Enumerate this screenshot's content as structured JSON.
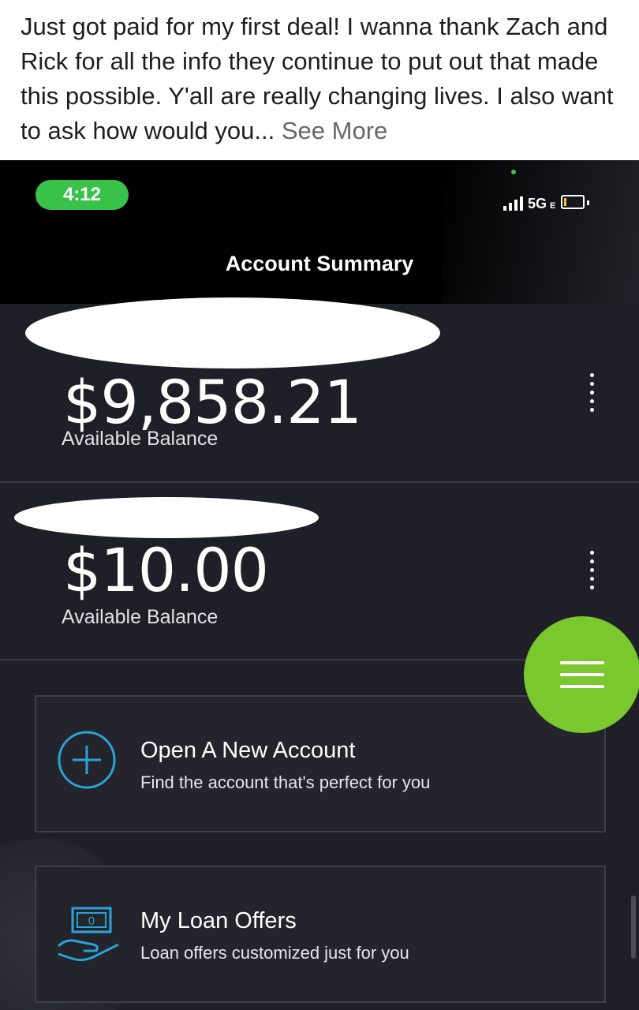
{
  "post": {
    "text": "Just got paid for my first deal! I wanna thank Zach and Rick for all the info they continue to put out that made this possible. Y'all are really changing lives. I also want to ask how would you...",
    "see_more": "See More"
  },
  "status_bar": {
    "time": "4:12",
    "network": "5G",
    "network_suffix": "E"
  },
  "header": {
    "title": "Account Summary"
  },
  "accounts": [
    {
      "balance": "$9,858.21",
      "label": "Available Balance"
    },
    {
      "balance": "$10.00",
      "label": "Available Balance"
    }
  ],
  "actions": [
    {
      "title": "Open A New Account",
      "subtitle": "Find the account that's perfect for you",
      "icon": "plus-circle-icon"
    },
    {
      "title": "My Loan Offers",
      "subtitle": "Loan offers customized just for you",
      "icon": "money-hand-icon"
    }
  ],
  "colors": {
    "accent_green": "#7ac82e",
    "time_pill_green": "#39c24a",
    "icon_blue": "#2aa3d8",
    "background": "#1f2027"
  }
}
